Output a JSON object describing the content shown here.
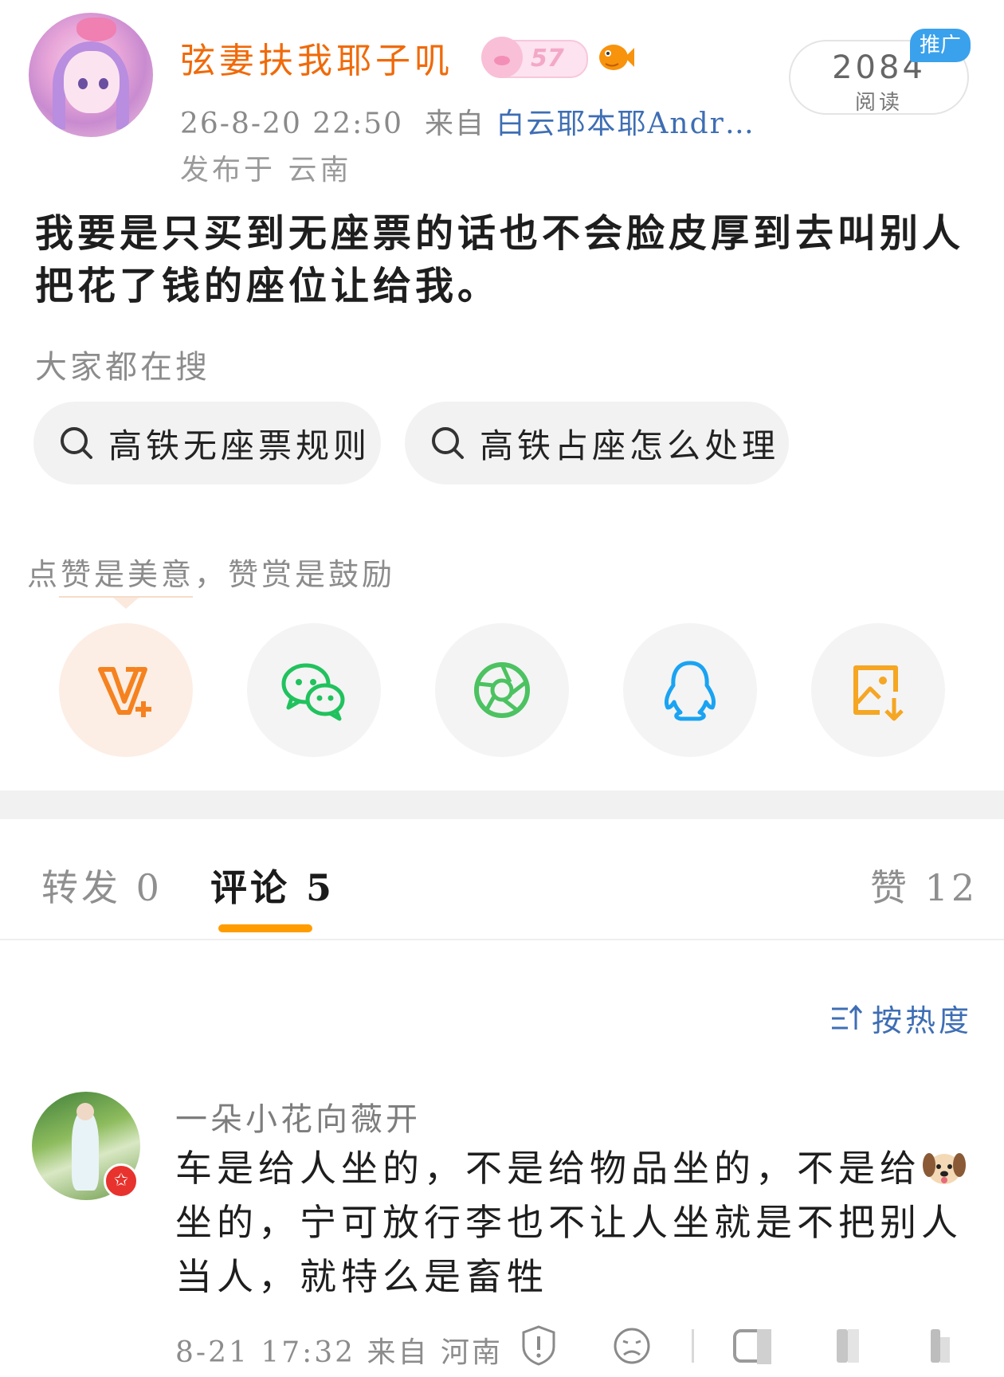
{
  "post": {
    "author": "弦妻扶我耶子叽",
    "level": "57",
    "time": "26-8-20 22:50",
    "from_label": "来自",
    "source": "白云耶本耶Andr…",
    "location": "发布于 云南",
    "read_count": "2084",
    "read_label": "阅读",
    "promo_tag": "推广",
    "text": "我要是只买到无座票的话也不会脸皮厚到去叫别人把花了钱的座位让给我。"
  },
  "search": {
    "title": "大家都在搜",
    "suggestions": [
      "高铁无座票规则",
      "高铁占座怎么处理"
    ]
  },
  "reward": {
    "text": "点赞是美意，赞赏是鼓励"
  },
  "share": {
    "buttons": [
      {
        "icon": "v-plus-icon",
        "color": "#f5821f"
      },
      {
        "icon": "wechat-icon",
        "color": "#21c25e"
      },
      {
        "icon": "moments-icon",
        "color": "#4cc261"
      },
      {
        "icon": "qq-icon",
        "color": "#1aa3f2"
      },
      {
        "icon": "save-image-icon",
        "color": "#f5a623"
      }
    ]
  },
  "tabs": {
    "repost": "转发 0",
    "comment": "评论 5",
    "like": "赞 12"
  },
  "sort": {
    "label": "按热度"
  },
  "comments": [
    {
      "name": "一朵小花向薇开",
      "text_before": "车是给人坐的，不是给物品坐的，不是给",
      "emoji": "dog-face-icon",
      "text_after": "坐的，宁可放行李也不让人坐就是不把别人当人，就特么是畜牲",
      "meta": "8-21 17:32 来自 河南"
    }
  ],
  "colors": {
    "username": "#f06a0a",
    "link": "#3e6eb4",
    "tab_indicator": "#ff9d00",
    "promo": "#3aa1ec"
  }
}
